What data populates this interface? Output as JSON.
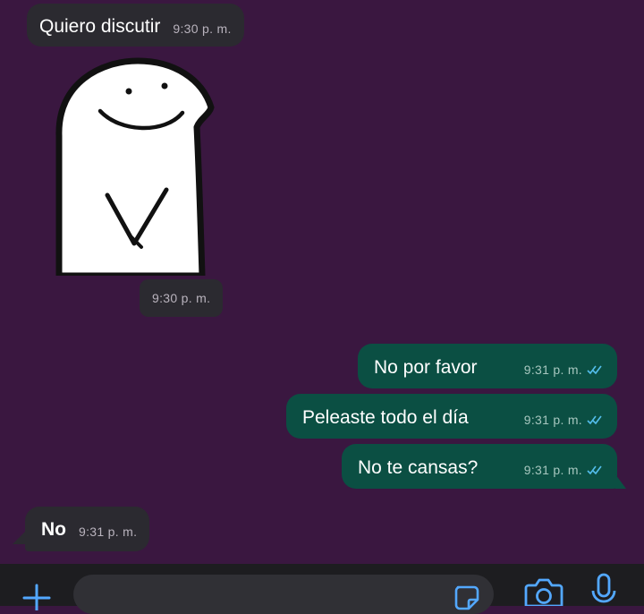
{
  "messages": [
    {
      "direction": "incoming",
      "type": "text",
      "text": "Quiero discutir",
      "time": "9:30 p. m."
    },
    {
      "direction": "incoming",
      "type": "sticker",
      "sticker": "flork-blob-sticker",
      "time": "9:30 p. m."
    },
    {
      "direction": "outgoing",
      "type": "text",
      "text": "No por favor",
      "time": "9:31 p. m.",
      "status": "read-double-check"
    },
    {
      "direction": "outgoing",
      "type": "text",
      "text": "Peleaste todo el día",
      "time": "9:31 p. m.",
      "status": "read-double-check"
    },
    {
      "direction": "outgoing",
      "type": "text",
      "text": "No te cansas?",
      "time": "9:31 p. m.",
      "status": "read-double-check"
    },
    {
      "direction": "incoming",
      "type": "text",
      "text": "No",
      "time": "9:31 p. m."
    }
  ],
  "input_bar": {
    "icons": [
      "plus-icon",
      "sticker-icon",
      "camera-icon",
      "microphone-icon"
    ]
  },
  "colors": {
    "background": "#3a1740",
    "incoming_bubble": "#2b2a30",
    "outgoing_bubble": "#0b4f43",
    "accent": "#53a8ff",
    "read_ticks": "#53bdeb"
  }
}
